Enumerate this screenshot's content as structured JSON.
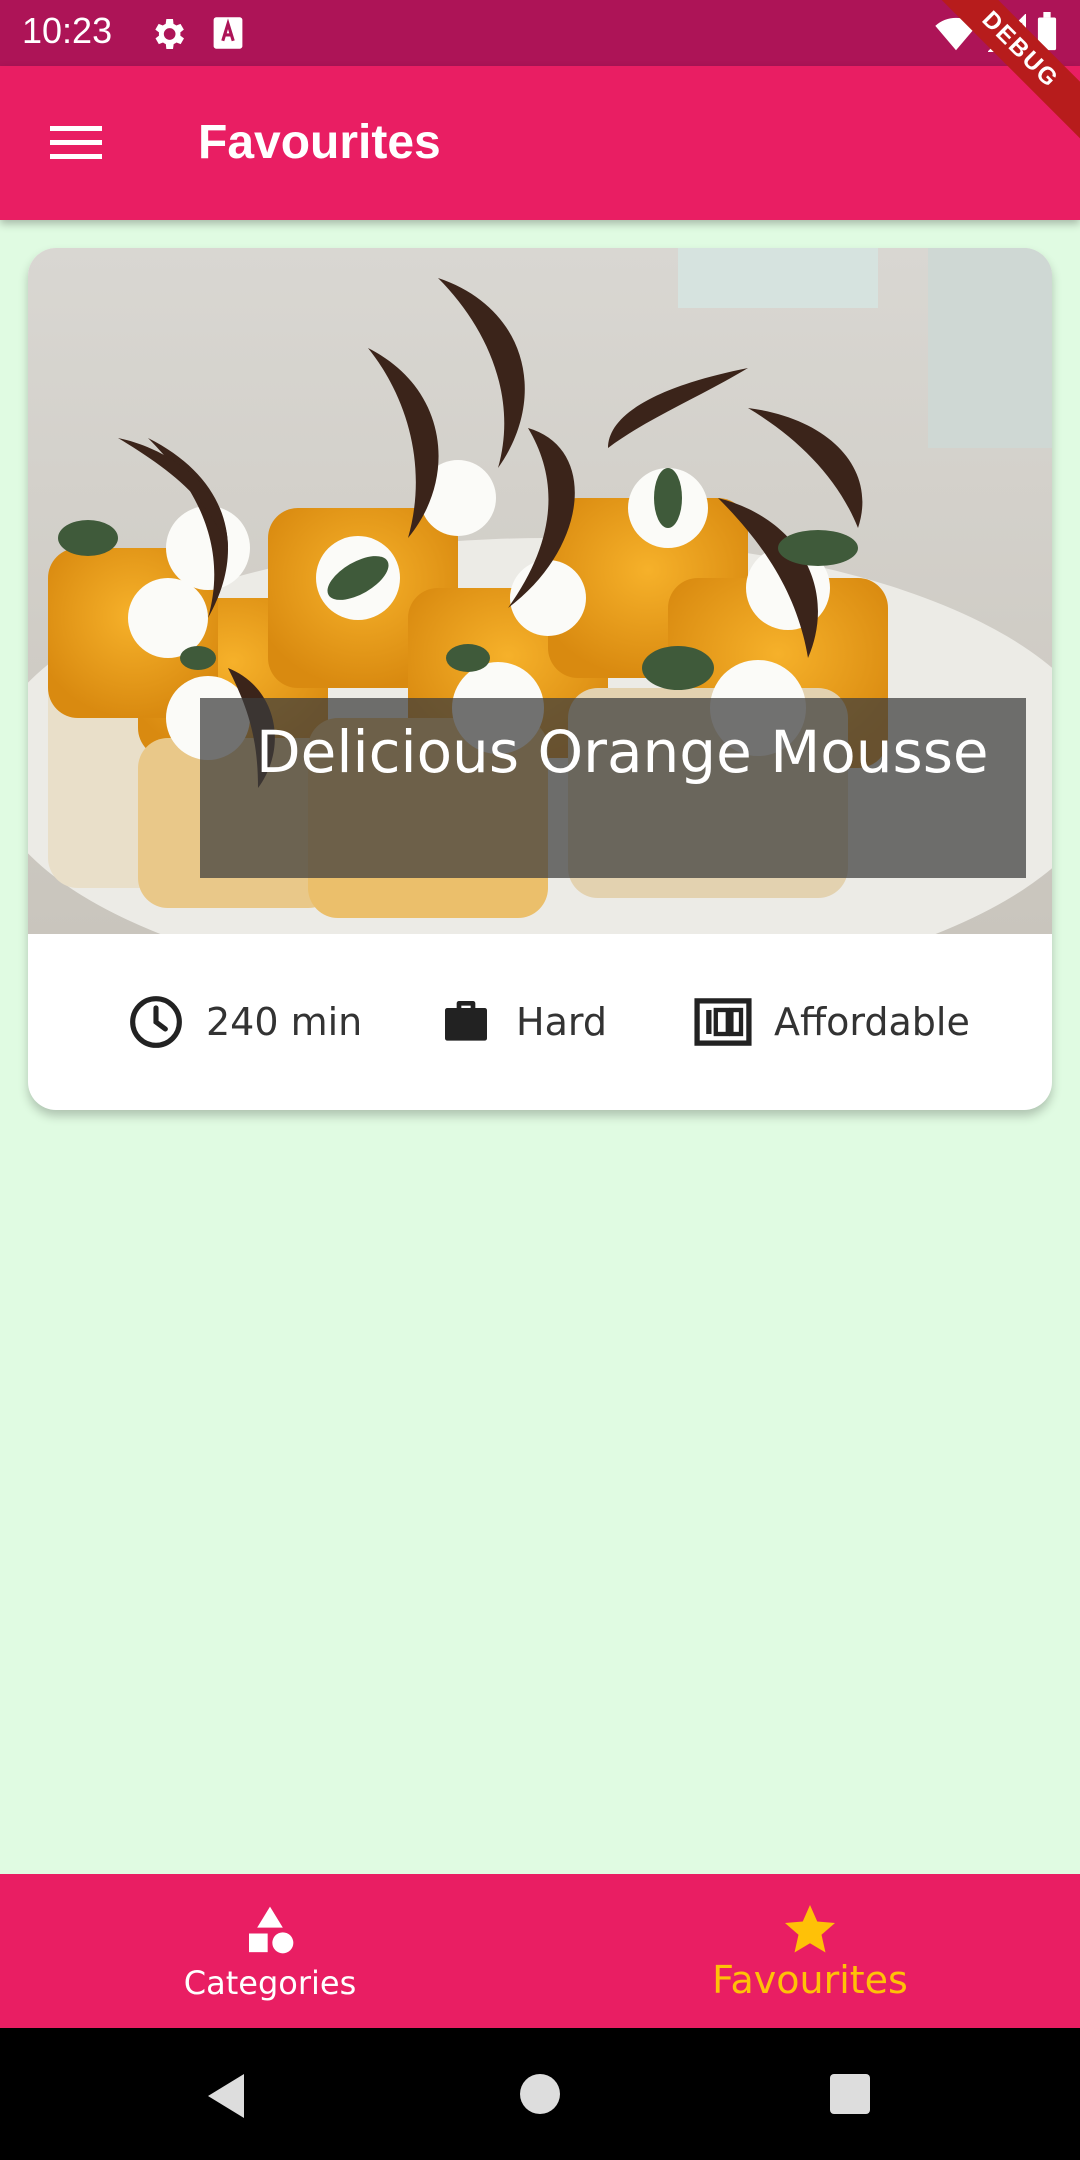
{
  "status_bar": {
    "time": "10:23"
  },
  "debug_banner": "DEBUG",
  "app_bar": {
    "title": "Favourites"
  },
  "meal": {
    "title": "Delicious Orange Mousse",
    "duration": "240 min",
    "complexity": "Hard",
    "affordability": "Affordable"
  },
  "bottom_nav": {
    "items": [
      {
        "label": "Categories",
        "icon": "categories-icon",
        "selected": false
      },
      {
        "label": "Favourites",
        "icon": "star-icon",
        "selected": true
      }
    ]
  },
  "colors": {
    "primary": "#e91e63",
    "primary_dark": "#ad1457",
    "accent": "#ffc107",
    "background": "#e0fbe2"
  }
}
